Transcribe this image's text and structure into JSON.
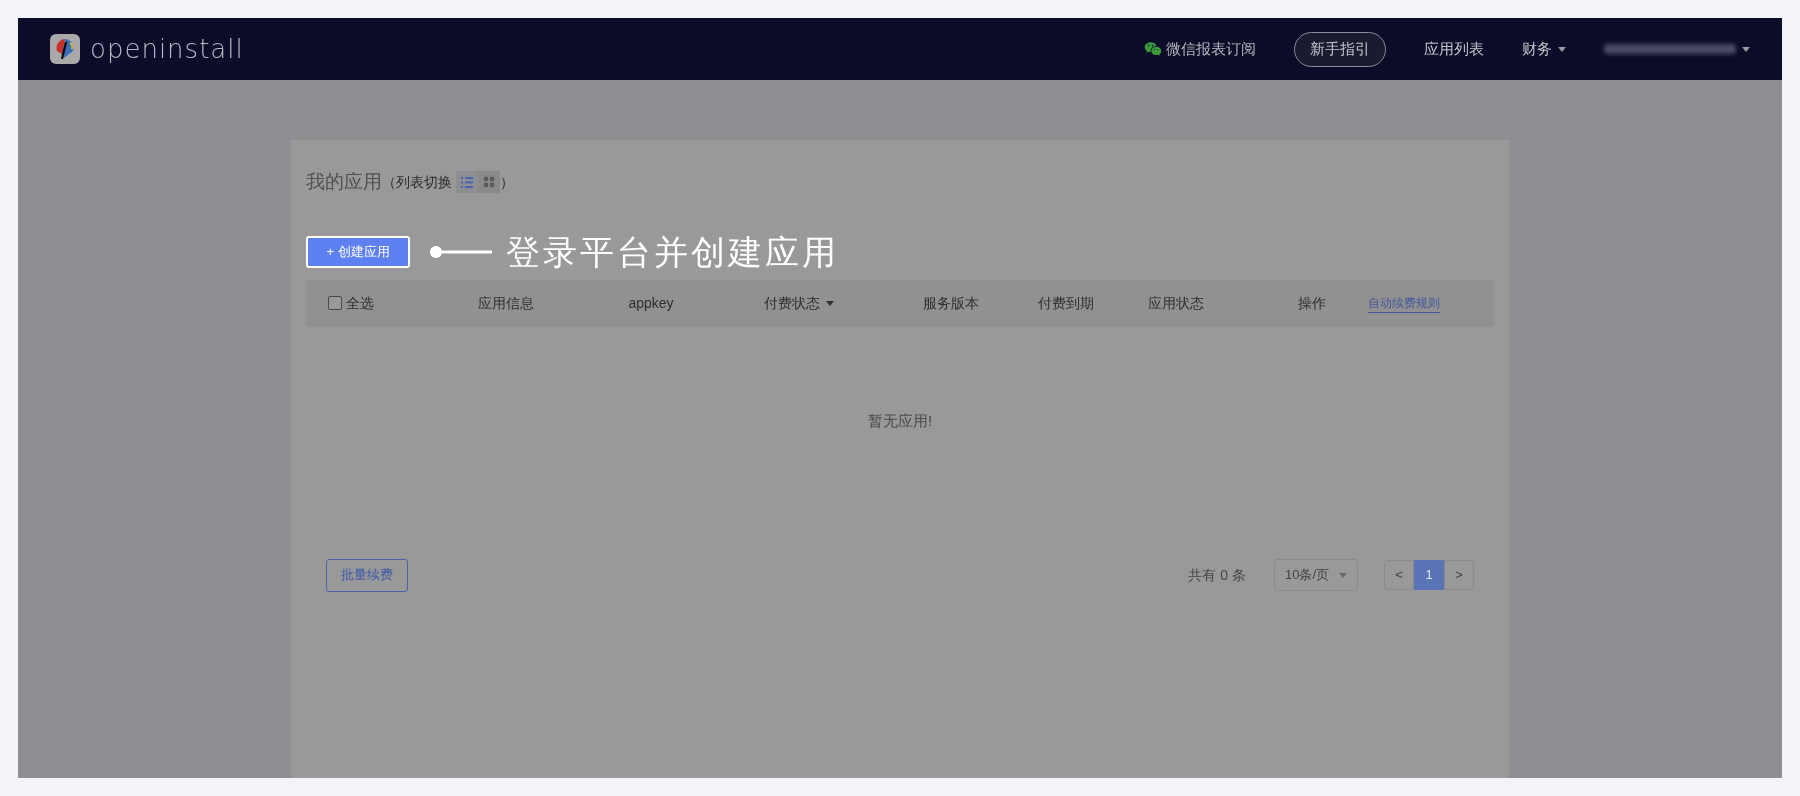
{
  "header": {
    "logo": "openinstall",
    "nav": [
      {
        "kind": "wechat",
        "label": "微信报表订阅"
      },
      {
        "kind": "outlined",
        "label": "新手指引"
      },
      {
        "kind": "link",
        "label": "应用列表"
      },
      {
        "kind": "dropdown",
        "label": "财务"
      },
      {
        "kind": "blurred"
      }
    ]
  },
  "page": {
    "title": "我的应用",
    "toggle_label": "（列表切换",
    "toggle_close": "）",
    "views": [
      {
        "kind": "list",
        "selected": true
      },
      {
        "kind": "grid",
        "selected": false
      }
    ],
    "create_button": "+ 创建应用",
    "callout": "登录平台并创建应用",
    "table": {
      "columns": [
        {
          "kind": "checkbox",
          "label": "全选",
          "checked": false
        },
        {
          "kind": "text",
          "label": "应用信息"
        },
        {
          "kind": "text",
          "label": "appkey"
        },
        {
          "kind": "sort",
          "label": "付费状态"
        },
        {
          "kind": "text",
          "label": "服务版本"
        },
        {
          "kind": "text",
          "label": "付费到期"
        },
        {
          "kind": "text",
          "label": "应用状态"
        },
        {
          "kind": "text",
          "label": "操作"
        },
        {
          "kind": "link",
          "label": "自动续费规则"
        }
      ],
      "empty": "暂无应用!"
    },
    "batch_button": "批量续费",
    "pagination": {
      "total": "共有 0 条",
      "page_size": "10条/页",
      "pages": [
        {
          "kind": "prev",
          "label": "<",
          "selected": false
        },
        {
          "kind": "page",
          "label": "1",
          "selected": true
        },
        {
          "kind": "next",
          "label": ">",
          "selected": false
        }
      ]
    }
  }
}
